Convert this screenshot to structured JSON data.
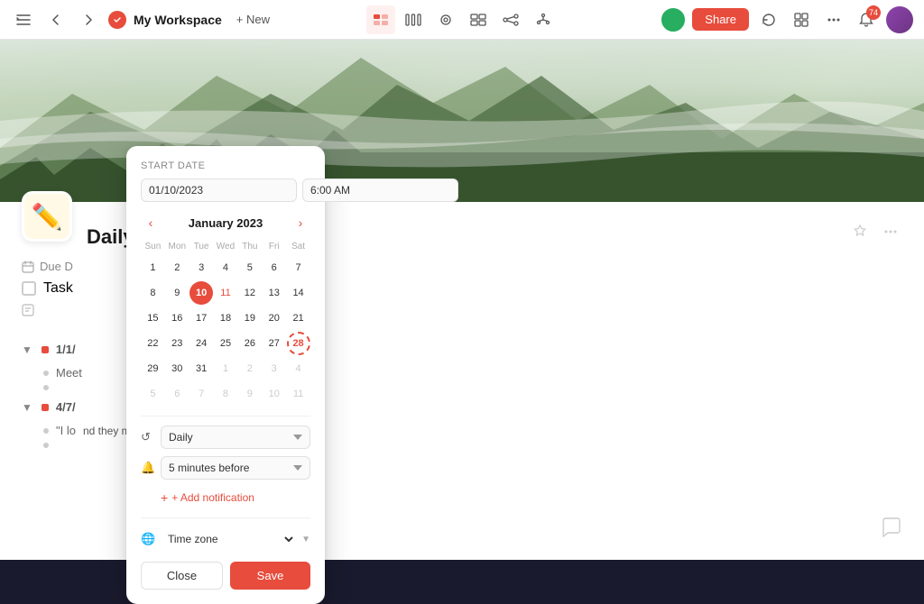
{
  "topnav": {
    "workspace_name": "My Workspace",
    "new_label": "+ New",
    "share_label": "Share",
    "notification_count": "74"
  },
  "hero": {
    "alt": "Mountain landscape with fog"
  },
  "page": {
    "title": "Daily L",
    "due_date_label": "Due D",
    "task_label": "Task"
  },
  "sections": [
    {
      "id": "1",
      "label": "1/1/",
      "sub": "Meet",
      "dot_color": "#e74c3c"
    },
    {
      "id": "2",
      "label": "4/7/",
      "sub": "\"I lo",
      "dot_color": "#e74c3c"
    }
  ],
  "quote": "nd they make as they fly by.\" —Douglas Adams",
  "datepicker": {
    "label": "Start date",
    "date_value": "01/10/2023",
    "time_value": "6:00 AM",
    "month_year": "January 2023",
    "day_headers": [
      "Sun",
      "Mon",
      "Tue",
      "Wed",
      "Thu",
      "Fri",
      "Sat"
    ],
    "weeks": [
      [
        "1",
        "2",
        "3",
        "4",
        "5",
        "6",
        "7"
      ],
      [
        "8",
        "9",
        "10",
        "11",
        "12",
        "13",
        "14"
      ],
      [
        "15",
        "16",
        "17",
        "18",
        "19",
        "20",
        "21"
      ],
      [
        "22",
        "23",
        "24",
        "25",
        "26",
        "27",
        "28"
      ],
      [
        "29",
        "30",
        "31",
        "1",
        "2",
        "3",
        "4"
      ],
      [
        "5",
        "6",
        "7",
        "8",
        "9",
        "10",
        "11"
      ]
    ],
    "today_day": "10",
    "highlighted_day": "11",
    "selected_day": "28",
    "repeat_label": "Daily",
    "notification_label": "5 minutes before",
    "add_notification_label": "+ Add notification",
    "timezone_label": "Time zone",
    "close_label": "Close",
    "save_label": "Save"
  }
}
